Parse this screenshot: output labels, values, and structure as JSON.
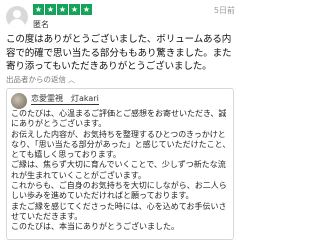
{
  "review": {
    "stars": 5,
    "star_glyph": "★",
    "date": "5日前",
    "reviewer_name": "匿名",
    "text": "この度はありがとうございました、ボリュームある内容で的確で思い当たる部分ももあり驚きました。また寄り添ってもいただきありがとうございました。"
  },
  "reply_toggle": {
    "label": "出品者からの返信",
    "icon": "chevron-up"
  },
  "seller_reply": {
    "seller_name": "恋愛霊視　灯akari",
    "lines": [
      "このたびは、心温まるご評価とご感想をお寄せいただき、誠にありがとうございます。",
      "お伝えした内容が、お気持ちを整理するひとつのきっかけとなり、「思い当たる部分があった」と感じていただけたこと、とても嬉しく思っております。",
      "ご縁は、焦らず大切に育んでいくことで、少しずつ新たな流れが生まれていくことがございます。",
      "これからも、ご自身のお気持ちを大切にしながら、お二人らしい歩みを進めていただければと願っております。",
      "またご縁を感じてくださった時には、心を込めてお手伝いさせていただきます。",
      "このたびは、本当にありがとうございました。"
    ]
  },
  "colors": {
    "star_bg": "#15a35a",
    "border": "#d8d8d8"
  }
}
